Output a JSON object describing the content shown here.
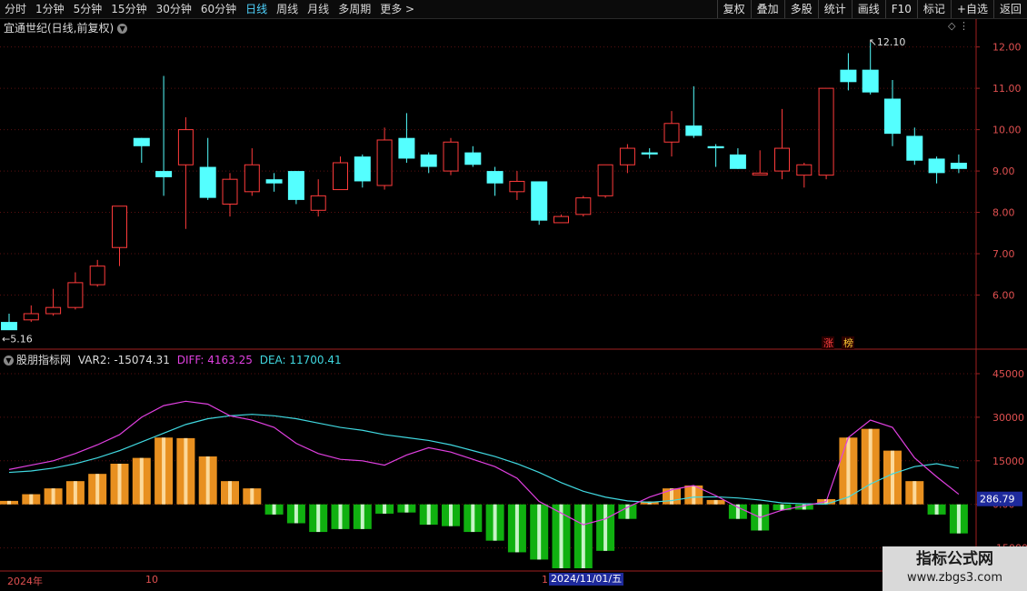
{
  "toolbar": {
    "periods": [
      "分时",
      "1分钟",
      "5分钟",
      "15分钟",
      "30分钟",
      "60分钟",
      "日线",
      "周线",
      "月线",
      "多周期",
      "更多 >"
    ],
    "active_period": "日线",
    "buttons": [
      "复权",
      "叠加",
      "多股",
      "统计",
      "画线",
      "F10",
      "标记",
      "+自选",
      "返回"
    ]
  },
  "main_chart": {
    "title": "宜通世纪(日线,前复权)",
    "high_label": "12.10",
    "low_label": "5.16",
    "badges": [
      "涨",
      "榜"
    ],
    "y_ticks": [
      "12.00",
      "11.00",
      "10.00",
      "9.00",
      "8.00",
      "7.00",
      "6.00"
    ]
  },
  "indicator": {
    "name": "股朋指标网",
    "var2_label": "VAR2: -15074.31",
    "diff_label": "DIFF: 4163.25",
    "dea_label": "DEA: 11700.41",
    "y_ticks": [
      "45000",
      "30000",
      "15000",
      "0.00",
      "-15000"
    ],
    "current_value": "286.79"
  },
  "x_axis": {
    "year_label": "2024年",
    "month_label": "10",
    "mark_label": "1",
    "cursor_date": "2024/11/01/五"
  },
  "colors": {
    "up": "#ff3b3b",
    "down": "#54ffff",
    "diff": "#e040e0",
    "dea": "#40d8e0",
    "bar_up": "#e89020",
    "bar_down": "#10b010",
    "axis": "#e05050"
  },
  "watermark": {
    "line1": "指标公式网",
    "line2": "www.zbgs3.com"
  },
  "chart_data": {
    "type": "candlestick",
    "ylim": [
      5.0,
      12.3
    ],
    "candles": [
      [
        5.35,
        5.15,
        5.55,
        5.16
      ],
      [
        5.4,
        5.55,
        5.75,
        5.35
      ],
      [
        5.55,
        5.7,
        6.15,
        5.5
      ],
      [
        5.7,
        6.3,
        6.55,
        5.65
      ],
      [
        6.25,
        6.7,
        6.85,
        6.2
      ],
      [
        7.15,
        8.15,
        8.15,
        6.7
      ],
      [
        9.8,
        9.6,
        9.8,
        9.2
      ],
      [
        9.0,
        8.85,
        11.3,
        8.4
      ],
      [
        9.15,
        10.0,
        10.3,
        7.6
      ],
      [
        9.1,
        8.35,
        9.8,
        8.3
      ],
      [
        8.2,
        8.8,
        8.95,
        7.9
      ],
      [
        8.5,
        9.15,
        9.55,
        8.4
      ],
      [
        8.8,
        8.7,
        8.95,
        8.5
      ],
      [
        9.0,
        8.3,
        9.0,
        8.2
      ],
      [
        8.05,
        8.4,
        8.8,
        7.9
      ],
      [
        8.55,
        9.2,
        9.35,
        8.55
      ],
      [
        9.35,
        8.75,
        9.4,
        8.6
      ],
      [
        8.65,
        9.75,
        10.05,
        8.55
      ],
      [
        9.8,
        9.3,
        10.4,
        9.2
      ],
      [
        9.4,
        9.1,
        9.45,
        8.95
      ],
      [
        9.0,
        9.7,
        9.8,
        8.9
      ],
      [
        9.45,
        9.15,
        9.6,
        9.1
      ],
      [
        9.0,
        8.7,
        9.1,
        8.4
      ],
      [
        8.5,
        8.75,
        9.0,
        8.3
      ],
      [
        8.75,
        7.8,
        8.75,
        7.7
      ],
      [
        7.75,
        7.9,
        7.95,
        7.75
      ],
      [
        7.95,
        8.35,
        8.4,
        7.9
      ],
      [
        8.4,
        9.15,
        9.15,
        8.35
      ],
      [
        9.15,
        9.55,
        9.65,
        8.95
      ],
      [
        9.45,
        9.4,
        9.55,
        9.3
      ],
      [
        9.7,
        10.15,
        10.45,
        9.35
      ],
      [
        10.1,
        9.85,
        11.05,
        9.8
      ],
      [
        9.6,
        9.55,
        9.65,
        9.1
      ],
      [
        9.4,
        9.05,
        9.55,
        9.05
      ],
      [
        8.95,
        8.95,
        9.5,
        8.9
      ],
      [
        9.0,
        9.55,
        10.5,
        8.8
      ],
      [
        8.9,
        9.15,
        9.2,
        8.6
      ],
      [
        8.9,
        11.0,
        11.0,
        8.8
      ],
      [
        11.45,
        11.15,
        11.85,
        10.95
      ],
      [
        11.45,
        10.9,
        12.1,
        10.85
      ],
      [
        10.75,
        9.9,
        11.2,
        9.6
      ],
      [
        9.85,
        9.25,
        10.05,
        9.15
      ],
      [
        9.3,
        8.95,
        9.35,
        8.7
      ],
      [
        9.2,
        9.05,
        9.4,
        8.95
      ]
    ],
    "indicator": {
      "ylim": [
        -22000,
        50000
      ],
      "var2": [
        1200,
        3500,
        5500,
        8000,
        10500,
        14000,
        16000,
        23000,
        22800,
        16500,
        8000,
        5500,
        -3500,
        -6500,
        -9500,
        -8500,
        -8500,
        -3200,
        -2800,
        -7000,
        -7500,
        -9500,
        -12500,
        -16500,
        -19000,
        -22000,
        -22000,
        -16000,
        -5000,
        1000,
        5500,
        6500,
        1500,
        -5000,
        -9000,
        -2000,
        -1800,
        1800,
        23000,
        26000,
        18500,
        8000,
        -3500,
        -10000
      ],
      "diff": [
        12000,
        13500,
        15000,
        17500,
        20500,
        24000,
        30000,
        34000,
        35500,
        34500,
        30500,
        29000,
        26500,
        21000,
        17500,
        15500,
        15000,
        13500,
        17000,
        19500,
        18000,
        15500,
        13000,
        9000,
        1000,
        -3000,
        -7000,
        -5000,
        -1000,
        2500,
        5000,
        6500,
        3000,
        -1000,
        -4500,
        -2000,
        -500,
        1000,
        23000,
        29000,
        26500,
        16000,
        9500,
        3500
      ],
      "dea": [
        11000,
        11500,
        12500,
        14000,
        16000,
        18500,
        21500,
        24500,
        27500,
        29500,
        30500,
        31000,
        30500,
        29500,
        28000,
        26500,
        25500,
        24000,
        23000,
        22000,
        20500,
        18500,
        16500,
        14000,
        11000,
        7500,
        4500,
        2500,
        1200,
        700,
        1300,
        2500,
        2600,
        2200,
        1500,
        500,
        200,
        100,
        2500,
        7000,
        10500,
        13000,
        14000,
        12500
      ]
    }
  }
}
